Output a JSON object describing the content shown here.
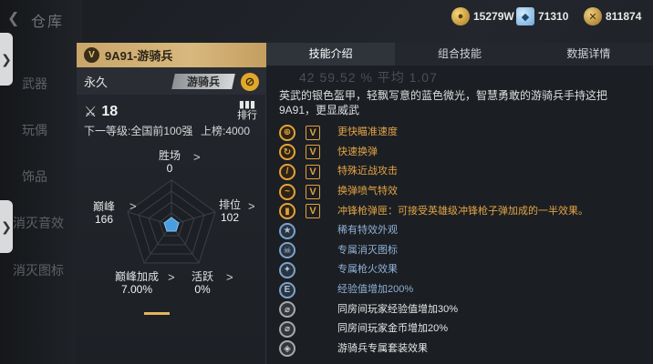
{
  "background": {
    "title": "仓库",
    "back_icon": "back-arrow-icon",
    "nav_items": [
      "武器",
      "玩偶",
      "饰品",
      "消灭音效",
      "消灭图标"
    ]
  },
  "currency": [
    {
      "icon": "gold-coin-icon",
      "value": "15279W"
    },
    {
      "icon": "diamond-icon",
      "value": "71310"
    },
    {
      "icon": "medal-icon",
      "value": "811874"
    }
  ],
  "card": {
    "title": "9A91-游骑兵",
    "duration": "永久",
    "class_tag": "游骑兵",
    "rank": "18",
    "leaderboard_label": "排行",
    "next_level": "下一等级:全国前100强",
    "on_list": "上榜:4000",
    "stats": {
      "wins": {
        "label": "胜场",
        "value": "0"
      },
      "peak": {
        "label": "巅峰",
        "value": "166"
      },
      "ranking": {
        "label": "排位",
        "value": "102"
      },
      "peak_bonus": {
        "label": "巅峰加成",
        "value": "7.00%"
      },
      "active": {
        "label": "活跃",
        "value": "0%"
      }
    }
  },
  "tabs": [
    "技能介绍",
    "组合技能",
    "数据详情"
  ],
  "ghost_stats": "42   59.52 %   平均 1.07",
  "description": "英武的银色盔甲，轻飘写意的蓝色微光，智慧勇敢的游骑兵手持这把9A91，更显威武",
  "skills": [
    {
      "text": "更快瞄准速度",
      "tier": "orange",
      "icon": "crosshair-icon",
      "mark": "V"
    },
    {
      "text": "快速换弹",
      "tier": "orange",
      "icon": "reload-icon",
      "mark": "V"
    },
    {
      "text": "特殊近战攻击",
      "tier": "orange",
      "icon": "knife-icon",
      "mark": "V"
    },
    {
      "text": "换弹喷气特效",
      "tier": "orange",
      "icon": "smoke-icon",
      "mark": "V"
    },
    {
      "text": "冲锋枪弹匣：可接受英雄级冲锋枪子弹加成的一半效果。",
      "tier": "orange",
      "icon": "magazine-icon",
      "mark": "V"
    },
    {
      "text": "稀有特效外观",
      "tier": "blue",
      "icon": "star-icon",
      "mark": ""
    },
    {
      "text": "专属消灭图标",
      "tier": "blue",
      "icon": "skull-icon",
      "mark": ""
    },
    {
      "text": "专属枪火效果",
      "tier": "blue",
      "icon": "muzzle-flash-icon",
      "mark": ""
    },
    {
      "text": "经验值增加200%",
      "tier": "blue",
      "icon": "exp-icon",
      "mark": ""
    },
    {
      "text": "同房间玩家经验值增加30%",
      "tier": "gray",
      "icon": "exp-team-icon",
      "mark": ""
    },
    {
      "text": "同房间玩家金币增加20%",
      "tier": "gray",
      "icon": "coin-team-icon",
      "mark": ""
    },
    {
      "text": "游骑兵专属套装效果",
      "tier": "gray",
      "icon": "suit-icon",
      "mark": ""
    }
  ]
}
